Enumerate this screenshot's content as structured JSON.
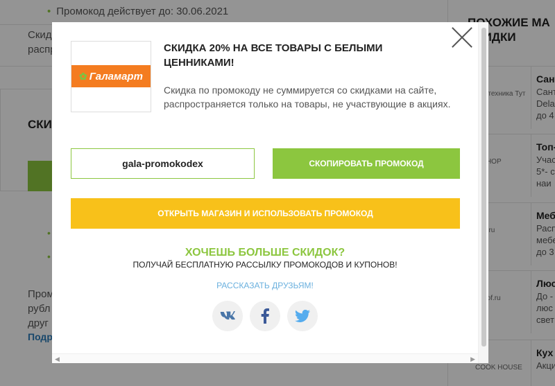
{
  "background": {
    "promo_valid_line": "Промокод действует до: 30.06.2021",
    "left_fragments": [
      "Скидк",
      "распр"
    ],
    "section_heading_fragment": "СКИД",
    "lower_fragments": [
      "Промо",
      "рубл",
      "друг"
    ],
    "more_link_fragment": "Подр",
    "right_heading": "ПОХОЖИЕ МА\nСКИДКИ",
    "stores": [
      {
        "logo": "Сантехника Тут",
        "name": "Сант",
        "sub": "Сант\nDela\nдо 4"
      },
      {
        "logo": "P SHOP",
        "name": "Топ-",
        "sub": "Учас\n5*- с\nнаи"
      },
      {
        "logo": "169.ru",
        "name": "Мебе",
        "sub": "Расп\nмебе\nдо 3"
      },
      {
        "logo": "estrof.ru",
        "name": "Люс",
        "sub": "До -\nлюс\nсвет"
      },
      {
        "logo": "COOK HOUSE",
        "name": "Кух",
        "sub": "Акци"
      }
    ]
  },
  "modal": {
    "brand_logo_text": "Галамарт",
    "title": "СКИДКА 20% НА ВСЕ ТОВАРЫ С БЕЛЫМИ ЦЕННИКАМИ!",
    "description": "Скидка по промокоду не суммируется со скидками на сайте, распространяется только на товары, не участвующие в акциях.",
    "promo_code": "gala-promokodex",
    "copy_button": "СКОПИРОВАТЬ ПРОМОКОД",
    "open_button": "ОТКРЫТЬ МАГАЗИН И ИСПОЛЬЗОВАТЬ ПРОМОКОД",
    "more_title": "ХОЧЕШЬ БОЛЬШЕ СКИДОК?",
    "more_subtitle": "ПОЛУЧАЙ БЕСПЛАТНУЮ РАССЫЛКУ ПРОМОКОДОВ И КУПОНОВ!",
    "share_text": "РАССКАЗАТЬ ДРУЗЬЯМ!",
    "social_icons": [
      "vk-icon",
      "facebook-icon",
      "twitter-icon"
    ]
  },
  "colors": {
    "accent_green": "#8cc63f",
    "accent_yellow": "#f8c11a",
    "brand_orange": "#f47c20",
    "link_blue": "#6ab0de"
  }
}
